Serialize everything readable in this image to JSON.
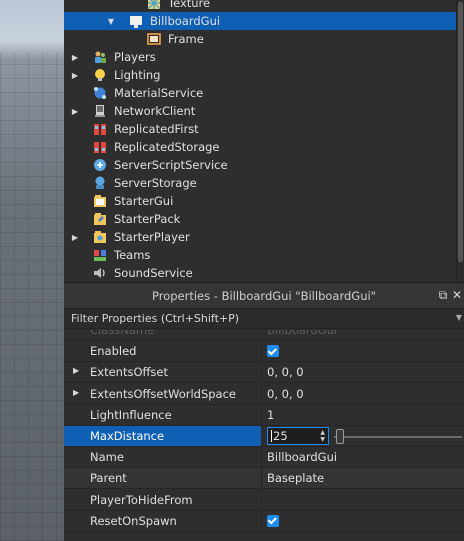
{
  "explorer": {
    "items": [
      {
        "label": "Texture",
        "icon": "texture-icon",
        "arrow": "",
        "indent": 3
      },
      {
        "label": "BillboardGui",
        "icon": "billboardgui-icon",
        "arrow": "▼",
        "indent": 2,
        "selected": true
      },
      {
        "label": "Frame",
        "icon": "frame-icon",
        "arrow": "",
        "indent": 3
      },
      {
        "label": "Players",
        "icon": "players-icon",
        "arrow": "▶",
        "indent": 0
      },
      {
        "label": "Lighting",
        "icon": "lighting-icon",
        "arrow": "▶",
        "indent": 0
      },
      {
        "label": "MaterialService",
        "icon": "material-service-icon",
        "arrow": "",
        "indent": 0
      },
      {
        "label": "NetworkClient",
        "icon": "network-client-icon",
        "arrow": "▶",
        "indent": 0
      },
      {
        "label": "ReplicatedFirst",
        "icon": "replicated-first-icon",
        "arrow": "",
        "indent": 0
      },
      {
        "label": "ReplicatedStorage",
        "icon": "replicated-storage-icon",
        "arrow": "",
        "indent": 0
      },
      {
        "label": "ServerScriptService",
        "icon": "server-script-service-icon",
        "arrow": "",
        "indent": 0
      },
      {
        "label": "ServerStorage",
        "icon": "server-storage-icon",
        "arrow": "",
        "indent": 0
      },
      {
        "label": "StarterGui",
        "icon": "starter-gui-icon",
        "arrow": "",
        "indent": 0
      },
      {
        "label": "StarterPack",
        "icon": "starter-pack-icon",
        "arrow": "",
        "indent": 0
      },
      {
        "label": "StarterPlayer",
        "icon": "starter-player-icon",
        "arrow": "▶",
        "indent": 0
      },
      {
        "label": "Teams",
        "icon": "teams-icon",
        "arrow": "",
        "indent": 0
      },
      {
        "label": "SoundService",
        "icon": "sound-service-icon",
        "arrow": "",
        "indent": 0
      }
    ]
  },
  "properties": {
    "title": "Properties - BillboardGui \"BillboardGui\"",
    "filter_placeholder": "Filter Properties (Ctrl+Shift+P)",
    "rows": [
      {
        "name": "ClassName",
        "value": "BillboardGui",
        "kind": "text",
        "dim": true
      },
      {
        "name": "Enabled",
        "value": "",
        "kind": "checkbox"
      },
      {
        "name": "ExtentsOffset",
        "value": "0, 0, 0",
        "kind": "text",
        "expandable": true
      },
      {
        "name": "ExtentsOffsetWorldSpace",
        "value": "0, 0, 0",
        "kind": "text",
        "expandable": true
      },
      {
        "name": "LightInfluence",
        "value": "1",
        "kind": "text"
      },
      {
        "name": "MaxDistance",
        "value": "25",
        "kind": "slider",
        "selected": true
      },
      {
        "name": "Name",
        "value": "BillboardGui",
        "kind": "text"
      },
      {
        "name": "Parent",
        "value": "Baseplate",
        "kind": "text",
        "alt": true
      },
      {
        "name": "PlayerToHideFrom",
        "value": "",
        "kind": "text"
      },
      {
        "name": "ResetOnSpawn",
        "value": "",
        "kind": "checkbox"
      }
    ]
  },
  "colors": {
    "selection": "#0f5fb4",
    "checkbox": "#1e8cf0",
    "panel": "#2e2e2e"
  }
}
